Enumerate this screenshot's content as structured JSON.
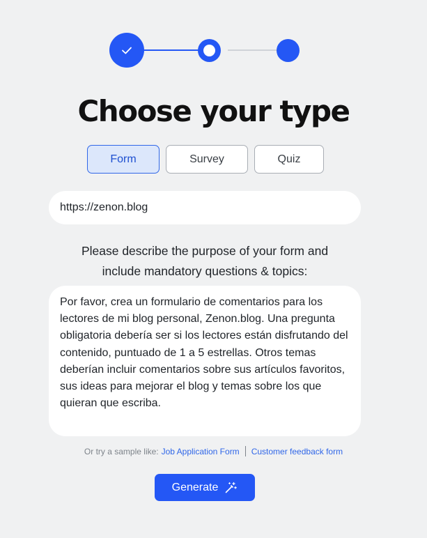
{
  "stepper": {
    "steps": [
      {
        "status": "completed",
        "icon": "check-icon"
      },
      {
        "status": "current"
      },
      {
        "status": "upcoming"
      }
    ]
  },
  "title": "Choose your type",
  "types": {
    "options": [
      "Form",
      "Survey",
      "Quiz"
    ],
    "selected": "Form"
  },
  "url_input": {
    "value": "https://zenon.blog"
  },
  "description": {
    "line1": "Please describe the purpose of your form and",
    "line2": "include mandatory questions & topics:"
  },
  "prompt": {
    "value": "Por favor, crea un formulario de comentarios para los lectores de mi blog personal, Zenon.blog. Una pregunta obligatoria debería ser si los lectores están disfrutando del contenido, puntuado de 1 a 5 estrellas. Otros temas deberían incluir comentarios sobre sus artículos favoritos, sus ideas para mejorar el blog y temas sobre los que quieran que escriba."
  },
  "samples": {
    "prefix": "Or try a sample like:",
    "links": [
      "Job Application Form",
      "Customer feedback form"
    ]
  },
  "generate": {
    "label": "Generate",
    "icon": "magic-wand-icon"
  },
  "colors": {
    "accent": "#2457f5",
    "background": "#f0f1f2",
    "selected_bg": "#dce7fb"
  }
}
